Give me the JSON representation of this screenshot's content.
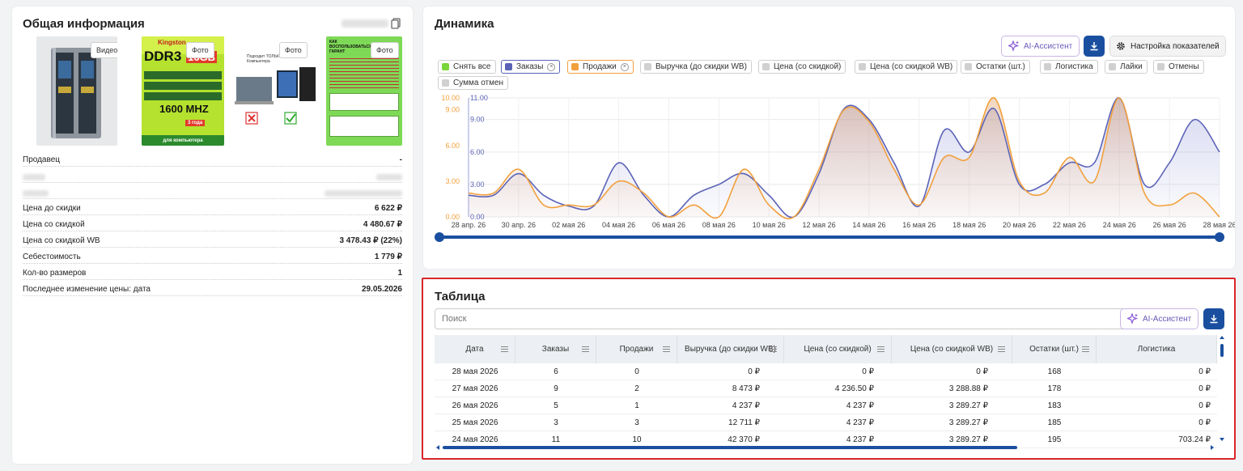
{
  "info": {
    "title": "Общая информация",
    "thumbs": [
      {
        "btn": "Видео"
      },
      {
        "btn": "Фото",
        "img_brand": "Kingston",
        "img_main": "DDR3",
        "img_size": "16GB",
        "img_freq": "1600 MHZ",
        "img_warranty": "3 года",
        "img_foot": "для компьютера"
      },
      {
        "btn": "Фото",
        "img_head": "Подходит ТОЛЬКО для Компьютера"
      },
      {
        "btn": "Фото",
        "img_head": "КАК ВОСПОЛЬЗОВАТЬСЯ ГАРАНТ"
      }
    ],
    "rows": [
      {
        "label": "Продавец",
        "value": "-"
      },
      {
        "label": "Цена до скидки",
        "value": "6 622 ₽"
      },
      {
        "label": "Цена со скидкой",
        "value": "4 480.67 ₽"
      },
      {
        "label": "Цена со скидкой WB",
        "value": "3 478.43 ₽ (22%)"
      },
      {
        "label": "Себестоимость",
        "value": "1 779 ₽"
      },
      {
        "label": "Кол-во размеров",
        "value": "1"
      },
      {
        "label": "Последнее изменение цены: дата",
        "value": "29.05.2026"
      }
    ]
  },
  "dynamics": {
    "title": "Динамика",
    "ai_label": "AI-Ассистент",
    "settings_label": "Настройка показателей",
    "chips": [
      {
        "label": "Снять все",
        "color": "#7bd63a",
        "close": false
      },
      {
        "label": "Заказы",
        "color": "#5b63b7",
        "close": true
      },
      {
        "label": "Продажи",
        "color": "#f2a03d",
        "close": true
      },
      {
        "label": "Выручка (до скидки WB)",
        "color": "#d0d0d0",
        "close": false
      },
      {
        "label": "Цена (со скидкой)",
        "color": "#d0d0d0",
        "close": false
      },
      {
        "label": "Цена (со скидкой WB)",
        "color": "#d0d0d0",
        "close": false
      },
      {
        "label": "Остатки (шт.)",
        "color": "#d0d0d0",
        "close": false
      },
      {
        "label": "Логистика",
        "color": "#d0d0d0",
        "close": false
      },
      {
        "label": "Лайки",
        "color": "#d0d0d0",
        "close": false
      },
      {
        "label": "Отмены",
        "color": "#d0d0d0",
        "close": false
      },
      {
        "label": "Сумма отмен",
        "color": "#d0d0d0",
        "close": false
      }
    ]
  },
  "chart_data": {
    "type": "area",
    "x_tick_labels": [
      "28 апр. 26",
      "30 апр. 26",
      "02 мая 26",
      "04 мая 26",
      "06 мая 26",
      "08 мая 26",
      "10 мая 26",
      "12 мая 26",
      "14 мая 26",
      "16 мая 26",
      "18 мая 26",
      "20 мая 26",
      "22 мая 26",
      "24 мая 26",
      "26 мая 26",
      "28 мая 26"
    ],
    "left_ticks": [
      "0.00",
      "3.00",
      "6.00",
      "9.00",
      "10.00"
    ],
    "right_ticks": [
      "0.00",
      "3.00",
      "6.00",
      "9.00",
      "11.00"
    ],
    "x": [
      "28 апр.",
      "29 апр.",
      "30 апр.",
      "01 мая",
      "02 мая",
      "03 мая",
      "04 мая",
      "05 мая",
      "06 мая",
      "07 мая",
      "08 мая",
      "09 мая",
      "10 мая",
      "11 мая",
      "12 мая",
      "13 мая",
      "14 мая",
      "15 мая",
      "16 мая",
      "17 мая",
      "18 мая",
      "19 мая",
      "20 мая",
      "21 мая",
      "22 мая",
      "23 мая",
      "24 мая",
      "25 мая",
      "26 мая",
      "27 мая",
      "28 мая"
    ],
    "series": [
      {
        "name": "Заказы",
        "color": "#5b63b7",
        "axis": "right",
        "ylim": [
          0,
          11
        ],
        "values": [
          2,
          2,
          4,
          2,
          1,
          1,
          5,
          2,
          0,
          2,
          3,
          4,
          2,
          0,
          4,
          10,
          9,
          5,
          1,
          8,
          6,
          10,
          3,
          3,
          5,
          5,
          11,
          3,
          5,
          9,
          6
        ]
      },
      {
        "name": "Продажи",
        "color": "#f2a03d",
        "axis": "left",
        "ylim": [
          0,
          10
        ],
        "values": [
          2,
          2,
          4,
          1,
          1,
          1,
          3,
          2,
          0,
          1,
          0,
          4,
          1,
          0,
          4,
          9,
          8,
          4,
          1,
          5,
          5,
          10,
          3,
          2,
          5,
          3,
          10,
          2,
          1,
          2,
          0
        ]
      }
    ],
    "grid": true,
    "range_slider": true
  },
  "table": {
    "title": "Таблица",
    "search_placeholder": "Поиск",
    "ai_label": "AI-Ассистент",
    "columns": [
      "Дата",
      "Заказы",
      "Продажи",
      "Выручка (до скидки WB)",
      "Цена (со скидкой)",
      "Цена (со скидкой WB)",
      "Остатки (шт.)",
      "Логистика"
    ],
    "rows": [
      [
        "28 мая 2026",
        "6",
        "0",
        "0 ₽",
        "0 ₽",
        "0 ₽",
        "168",
        "0 ₽"
      ],
      [
        "27 мая 2026",
        "9",
        "2",
        "8 473 ₽",
        "4 236.50 ₽",
        "3 288.88 ₽",
        "178",
        "0 ₽"
      ],
      [
        "26 мая 2026",
        "5",
        "1",
        "4 237 ₽",
        "4 237 ₽",
        "3 289.27 ₽",
        "183",
        "0 ₽"
      ],
      [
        "25 мая 2026",
        "3",
        "3",
        "12 711 ₽",
        "4 237 ₽",
        "3 289.27 ₽",
        "185",
        "0 ₽"
      ],
      [
        "24 мая 2026",
        "11",
        "10",
        "42 370 ₽",
        "4 237 ₽",
        "3 289.27 ₽",
        "195",
        "703.24 ₽"
      ]
    ]
  }
}
